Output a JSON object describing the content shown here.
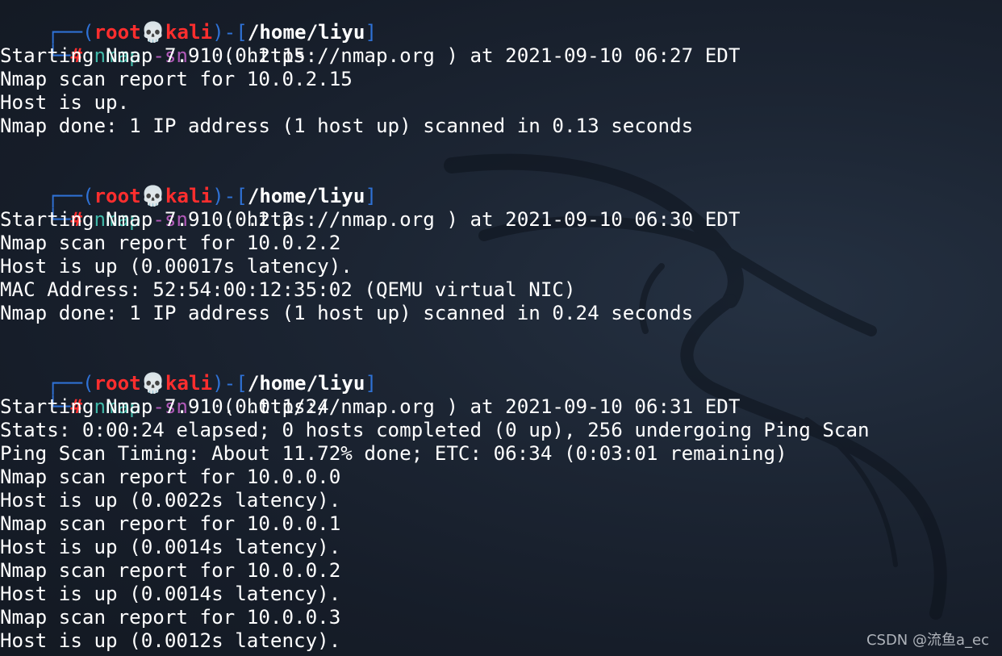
{
  "terminal": {
    "blocks": [
      {
        "prompt": {
          "corner_top": "┌──",
          "open": "(",
          "user": "root",
          "skull": "💀",
          "host": "kali",
          "close_sep": ")-[",
          "path": "/home/liyu",
          "close": "]",
          "corner_bottom": "└─",
          "hash": "#"
        },
        "command": {
          "name": "nmap",
          "option": "-sn",
          "target": "10.0.2.15"
        },
        "output": [
          "Starting Nmap 7.91 ( https://nmap.org ) at 2021-09-10 06:27 EDT",
          "Nmap scan report for 10.0.2.15",
          "Host is up.",
          "Nmap done: 1 IP address (1 host up) scanned in 0.13 seconds"
        ]
      },
      {
        "prompt": {
          "corner_top": "┌──",
          "open": "(",
          "user": "root",
          "skull": "💀",
          "host": "kali",
          "close_sep": ")-[",
          "path": "/home/liyu",
          "close": "]",
          "corner_bottom": "└─",
          "hash": "#"
        },
        "command": {
          "name": "nmap",
          "option": "-sn",
          "target": "10.0.2.2"
        },
        "output": [
          "Starting Nmap 7.91 ( https://nmap.org ) at 2021-09-10 06:30 EDT",
          "Nmap scan report for 10.0.2.2",
          "Host is up (0.00017s latency).",
          "MAC Address: 52:54:00:12:35:02 (QEMU virtual NIC)",
          "Nmap done: 1 IP address (1 host up) scanned in 0.24 seconds"
        ]
      },
      {
        "prompt": {
          "corner_top": "┌──",
          "open": "(",
          "user": "root",
          "skull": "💀",
          "host": "kali",
          "close_sep": ")-[",
          "path": "/home/liyu",
          "close": "]",
          "corner_bottom": "└─",
          "hash": "#"
        },
        "command": {
          "name": "nmap",
          "option": "-sn",
          "target": "10.0.0.1/24"
        },
        "output": [
          "Starting Nmap 7.91 ( https://nmap.org ) at 2021-09-10 06:31 EDT",
          "Stats: 0:00:24 elapsed; 0 hosts completed (0 up), 256 undergoing Ping Scan",
          "Ping Scan Timing: About 11.72% done; ETC: 06:34 (0:03:01 remaining)",
          "Nmap scan report for 10.0.0.0",
          "Host is up (0.0022s latency).",
          "Nmap scan report for 10.0.0.1",
          "Host is up (0.0014s latency).",
          "Nmap scan report for 10.0.0.2",
          "Host is up (0.0014s latency).",
          "Nmap scan report for 10.0.0.3",
          "Host is up (0.0012s latency)."
        ]
      }
    ]
  },
  "watermark": "CSDN @流鱼a_ec",
  "colors": {
    "background": "#1a2230",
    "prompt_frame": "#2f72d6",
    "user_host": "#ff2e2e",
    "command": "#40b8a8",
    "option": "#b05ab8",
    "text": "#ffffff"
  },
  "background_icon": "kali-dragon-icon"
}
